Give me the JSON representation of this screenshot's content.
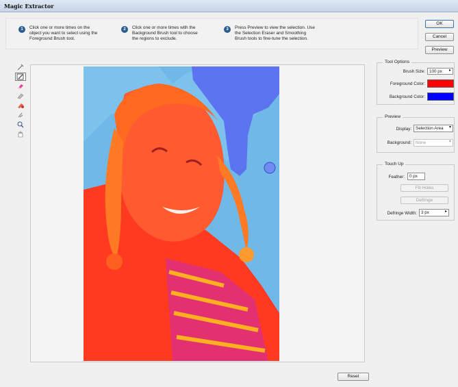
{
  "window": {
    "title": "Magic Extractor"
  },
  "instructions": [
    {
      "num": "1",
      "text": "Click one or more times on the\nobject you want to select using the\nForeground Brush tool."
    },
    {
      "num": "2",
      "text": "Click one or more times with the\nBackground Brush tool to choose\nthe regions to exclude."
    },
    {
      "num": "3",
      "text": "Press Preview to view the selection. Use\nthe Selection Eraser and Smoothing\nBrush tools to fine-tune the selection."
    }
  ],
  "buttons": {
    "ok": "OK",
    "cancel": "Cancel",
    "preview": "Preview",
    "reset": "Reset",
    "fill_holes": "Fill Holes",
    "defringe": "Defringe"
  },
  "tools": [
    "foreground-brush-icon",
    "background-brush-icon",
    "point-eraser-icon",
    "add-to-selection-icon",
    "remove-from-selection-icon",
    "smoothing-brush-icon",
    "zoom-icon",
    "hand-icon"
  ],
  "tool_options": {
    "title": "Tool Options",
    "brush_size_label": "Brush Size:",
    "brush_size_value": "100 px",
    "foreground_label": "Foreground Color:",
    "foreground_color": "#ff0000",
    "background_label": "Background Color:",
    "background_color": "#0000ff"
  },
  "preview": {
    "title": "Preview",
    "display_label": "Display:",
    "display_value": "Selection Area",
    "background_label": "Background:",
    "background_value": "None"
  },
  "touch_up": {
    "title": "Touch Up",
    "feather_label": "Feather:",
    "feather_value": "0 px",
    "defringe_width_label": "Defringe Width:",
    "defringe_width_value": "3 px"
  },
  "colors": {
    "overlay_red": "#ff3a20",
    "overlay_blue": "#5a6cf0",
    "sky": "#6fb8e8"
  }
}
